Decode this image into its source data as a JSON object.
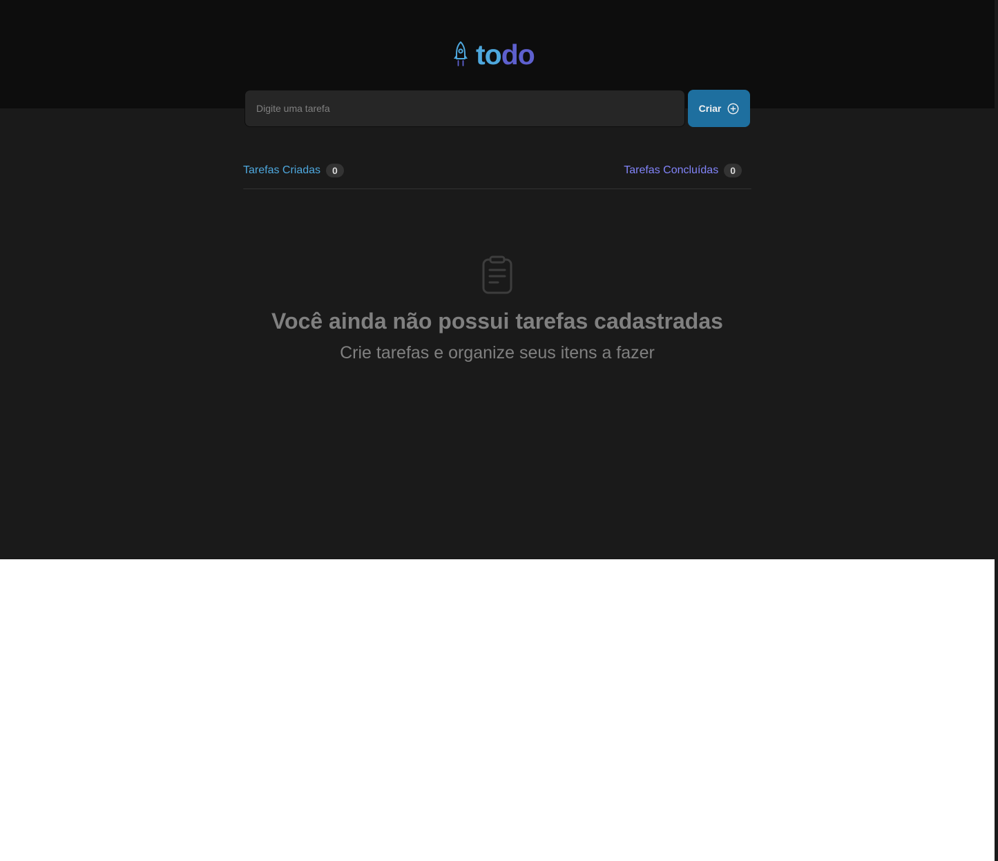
{
  "logo": {
    "icon": "rocket-icon",
    "text_part1": "to",
    "text_part2": "do",
    "color_part1": "#4ea8de",
    "color_part2": "#5e60ce"
  },
  "new_task": {
    "placeholder": "Digite uma tarefa",
    "value": "",
    "button_label": "Criar",
    "button_icon": "plus-circle-icon",
    "button_color": "#1e6f9f"
  },
  "counters": {
    "created_label": "Tarefas Criadas",
    "created_count": "0",
    "done_label": "Tarefas Concluídas",
    "done_count": "0"
  },
  "empty_state": {
    "icon": "clipboard-icon",
    "title": "Você ainda não possui tarefas cadastradas",
    "subtitle": "Crie tarefas e organize seus itens a fazer"
  },
  "colors": {
    "header_bg": "#0d0d0d",
    "app_bg": "#1a1a1a",
    "input_bg": "#262626",
    "muted_text": "#808080",
    "purple": "#8284fa"
  }
}
